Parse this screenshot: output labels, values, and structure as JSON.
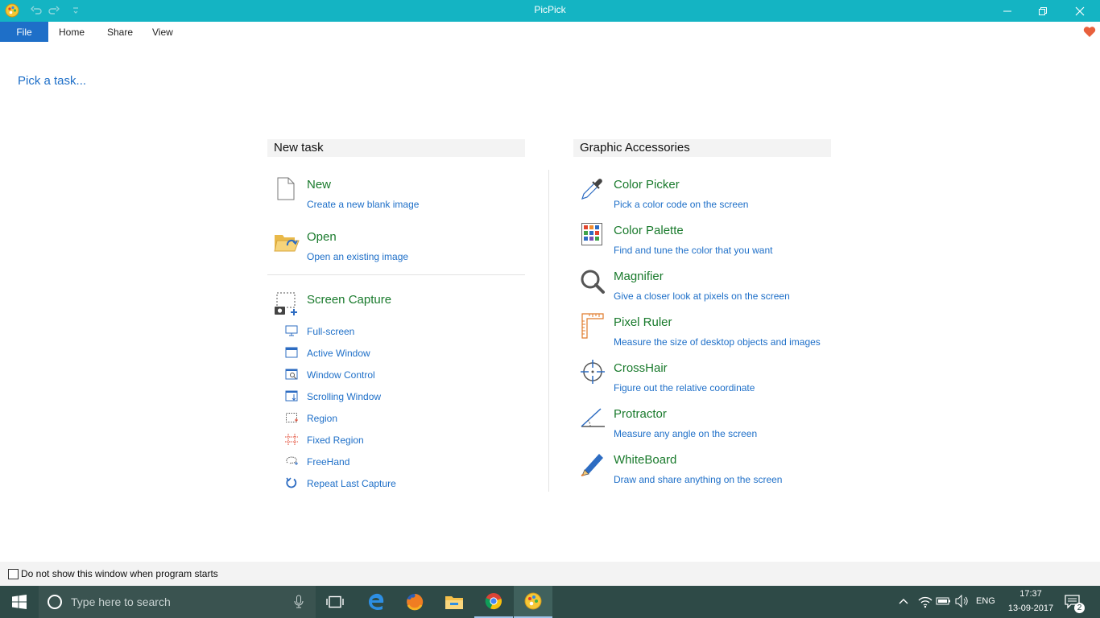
{
  "window": {
    "title": "PicPick",
    "controls": [
      "minimize",
      "restore",
      "close"
    ]
  },
  "menu": {
    "file": "File",
    "home": "Home",
    "share": "Share",
    "view": "View"
  },
  "pick_task": "Pick a task...",
  "new_task": {
    "heading": "New task",
    "new": {
      "title": "New",
      "desc": "Create a new blank image"
    },
    "open": {
      "title": "Open",
      "desc": "Open an existing image"
    },
    "screen_capture": {
      "title": "Screen Capture"
    },
    "capture_items": [
      {
        "label": "Full-screen",
        "icon": "monitor-icon"
      },
      {
        "label": "Active Window",
        "icon": "window-icon"
      },
      {
        "label": "Window Control",
        "icon": "window-control-icon"
      },
      {
        "label": "Scrolling Window",
        "icon": "scrolling-window-icon"
      },
      {
        "label": "Region",
        "icon": "region-icon"
      },
      {
        "label": "Fixed Region",
        "icon": "fixed-region-icon"
      },
      {
        "label": "FreeHand",
        "icon": "freehand-icon"
      },
      {
        "label": "Repeat Last Capture",
        "icon": "repeat-icon"
      }
    ]
  },
  "accessories": {
    "heading": "Graphic Accessories",
    "items": [
      {
        "title": "Color Picker",
        "desc": "Pick a color code on the screen",
        "icon": "eyedropper-icon"
      },
      {
        "title": "Color Palette",
        "desc": "Find and tune the color that you want",
        "icon": "palette-grid-icon"
      },
      {
        "title": "Magnifier",
        "desc": "Give a closer look at pixels on the screen",
        "icon": "magnifier-icon"
      },
      {
        "title": "Pixel Ruler",
        "desc": "Measure the size of desktop objects and images",
        "icon": "ruler-icon"
      },
      {
        "title": "CrossHair",
        "desc": "Figure out the relative coordinate",
        "icon": "crosshair-icon"
      },
      {
        "title": "Protractor",
        "desc": "Measure any angle on the screen",
        "icon": "protractor-icon"
      },
      {
        "title": "WhiteBoard",
        "desc": "Draw and share anything on the screen",
        "icon": "pen-icon"
      }
    ]
  },
  "footer": {
    "checkbox_label": "Do not show this window when program starts",
    "checked": false
  },
  "taskbar": {
    "search_placeholder": "Type here to search",
    "language": "ENG",
    "time": "17:37",
    "date": "13-09-2017",
    "notification_count": "2"
  },
  "colors": {
    "titlebar": "#14b4c3",
    "file_tab": "#1e6fc8",
    "link_blue": "#1e6fc8",
    "title_green": "#197a2c",
    "taskbar": "#2e4a47"
  }
}
